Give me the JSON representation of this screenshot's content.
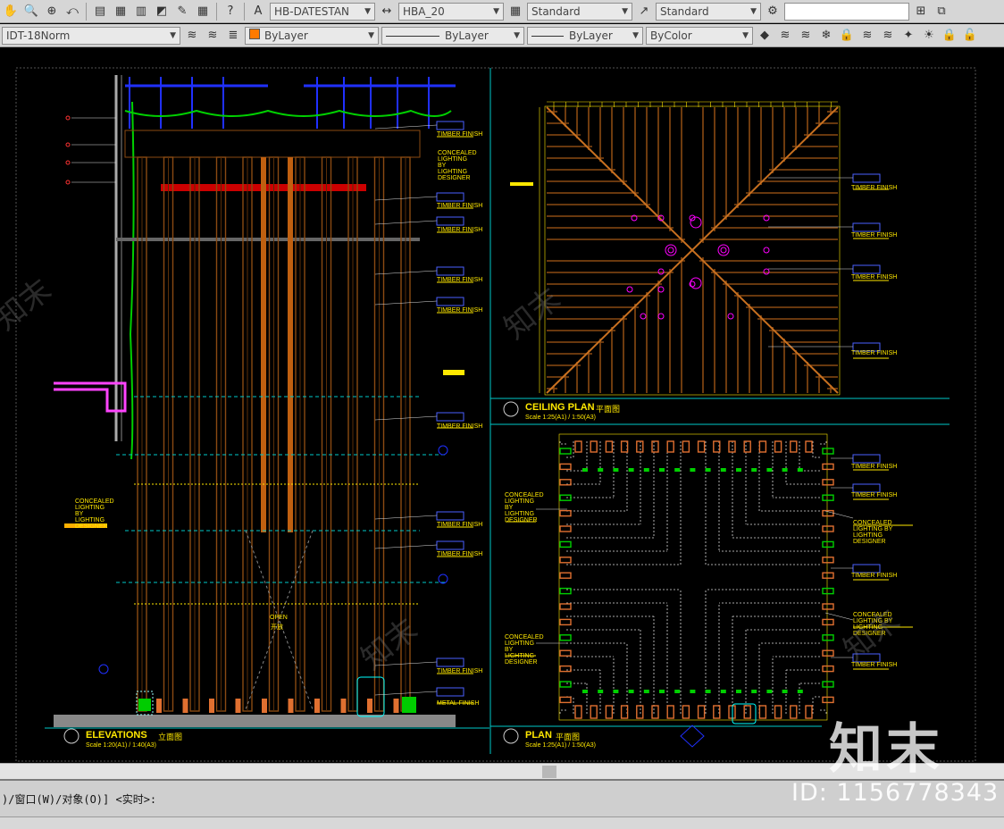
{
  "toolbar1": {
    "text_style": "HB-DATESTAN",
    "dim_style": "HBA_20",
    "table_style": "Standard",
    "multileader_style": "Standard"
  },
  "toolbar2": {
    "layer": "IDT-18Norm",
    "color": "ByLayer",
    "linetype": "ByLayer",
    "lineweight": "ByLayer",
    "plotstyle": "ByColor",
    "color_hex": "#ff7a00"
  },
  "drawing": {
    "elevations_title": "ELEVATIONS",
    "elevations_cn": "立面图",
    "elevations_scale": "Scale 1:20(A1) / 1:40(A3)",
    "ceiling_title": "CEILING PLAN",
    "ceiling_cn": "平面图",
    "ceiling_scale": "Scale 1:25(A1) / 1:50(A3)",
    "plan_title": "PLAN",
    "plan_cn": "平面图",
    "plan_scale": "Scale 1:25(A1) / 1:50(A3)",
    "open_label": "OPEN",
    "open_cn": "开放",
    "concealed_lighting": "CONCEALED LIGHTING BY LIGHTING DESIGNER",
    "timber_finish": "TIMBER FINISH",
    "metal_finish": "METAL FINISH"
  },
  "command": {
    "prompt": ")/窗口(W)/对象(O)] <实时>:"
  },
  "watermark": {
    "logo": "知末",
    "id": "ID: 1156778343"
  },
  "colors": {
    "background": "#000000",
    "timber": "#8a4a12",
    "cyan": "#00c8c8",
    "yellow": "#ffe800",
    "magenta": "#ff00ff",
    "blue": "#2030ff"
  }
}
